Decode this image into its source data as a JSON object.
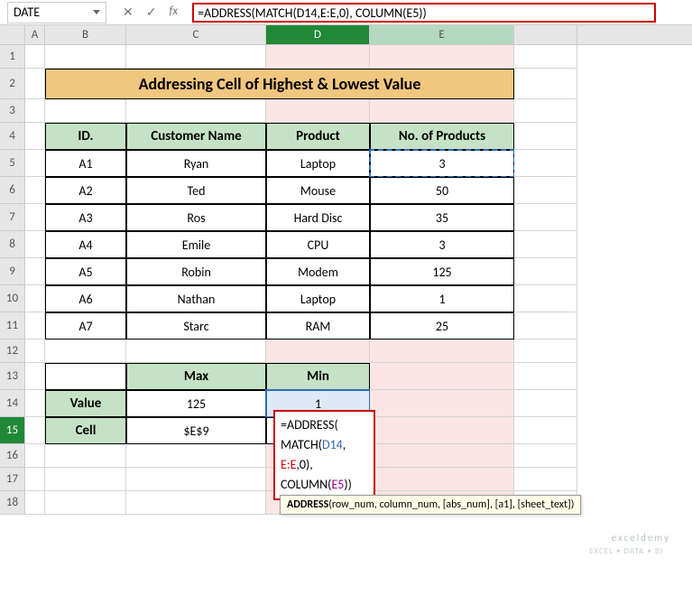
{
  "namebox": "DATE",
  "formula_bar": "=ADDRESS(MATCH(D14,E:E,0), COLUMN(E5))",
  "fx_label": "fx",
  "cancel_icon": "✕",
  "enter_icon": "✓",
  "cols": {
    "A": "A",
    "B": "B",
    "C": "C",
    "D": "D",
    "E": "E",
    "F": ""
  },
  "rows": [
    "1",
    "2",
    "3",
    "4",
    "5",
    "6",
    "7",
    "8",
    "9",
    "10",
    "11",
    "12",
    "13",
    "14",
    "15",
    "16",
    "17",
    "18"
  ],
  "title": "Addressing Cell of Highest & Lowest Value",
  "headers": {
    "id": "ID.",
    "cust": "Customer Name",
    "prod": "Product",
    "qty": "No. of Products"
  },
  "data": [
    {
      "id": "A1",
      "cust": "Ryan",
      "prod": "Laptop",
      "qty": "3"
    },
    {
      "id": "A2",
      "cust": "Ted",
      "prod": "Mouse",
      "qty": "50"
    },
    {
      "id": "A3",
      "cust": "Ros",
      "prod": "Hard Disc",
      "qty": "35"
    },
    {
      "id": "A4",
      "cust": "Emile",
      "prod": "CPU",
      "qty": "3"
    },
    {
      "id": "A5",
      "cust": "Robin",
      "prod": "Modem",
      "qty": "125"
    },
    {
      "id": "A6",
      "cust": "Nathan",
      "prod": "Laptop",
      "qty": "1"
    },
    {
      "id": "A7",
      "cust": "Starc",
      "prod": "RAM",
      "qty": "25"
    }
  ],
  "summary": {
    "max_h": "Max",
    "min_h": "Min",
    "value_h": "Value",
    "cell_h": "Cell",
    "max_v": "125",
    "min_v": "1",
    "max_c": "$E$9"
  },
  "formula_cell": {
    "l1": "=ADDRESS(",
    "l2a": "MATCH(",
    "l2b": "D14",
    "l2c": ",",
    "l3a": "E:E",
    "l3b": ",0),",
    "l4a": "COLUMN(",
    "l4b": "E5",
    "l4c": "))"
  },
  "tooltip": {
    "fn": "ADDRESS",
    "args": "(row_num, column_num, [abs_num], [a1], [sheet_text])"
  },
  "watermark": "exceldemy",
  "wm2": "EXCEL • DATA • BI",
  "chart_data": {
    "type": "table",
    "title": "Addressing Cell of Highest & Lowest Value",
    "columns": [
      "ID.",
      "Customer Name",
      "Product",
      "No. of Products"
    ],
    "rows": [
      [
        "A1",
        "Ryan",
        "Laptop",
        3
      ],
      [
        "A2",
        "Ted",
        "Mouse",
        50
      ],
      [
        "A3",
        "Ros",
        "Hard Disc",
        35
      ],
      [
        "A4",
        "Emile",
        "CPU",
        3
      ],
      [
        "A5",
        "Robin",
        "Modem",
        125
      ],
      [
        "A6",
        "Nathan",
        "Laptop",
        1
      ],
      [
        "A7",
        "Starc",
        "RAM",
        25
      ]
    ],
    "summary": {
      "Max Value": 125,
      "Min Value": 1,
      "Max Cell": "$E$9",
      "Min Cell formula": "=ADDRESS(MATCH(D14,E:E,0), COLUMN(E5))"
    }
  }
}
